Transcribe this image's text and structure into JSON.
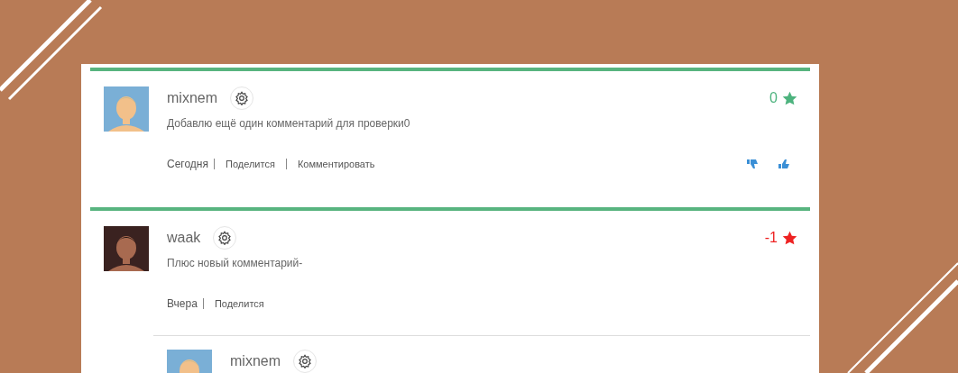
{
  "comments": [
    {
      "author": "mixnem",
      "text": "Добавлю ещё один комментарий для проверки0",
      "rating": "0",
      "color": "#4db37e",
      "date": "Сегодня",
      "actions": [
        "Поделится",
        "Комментировать"
      ],
      "votes": true
    },
    {
      "author": "waak",
      "text": "Плюс новый комментарий-",
      "rating": "-1",
      "color": "#ee2222",
      "date": "Вчера",
      "actions": [
        "Поделится"
      ],
      "votes": false,
      "replies": [
        {
          "author": "mixnem"
        }
      ]
    }
  ]
}
